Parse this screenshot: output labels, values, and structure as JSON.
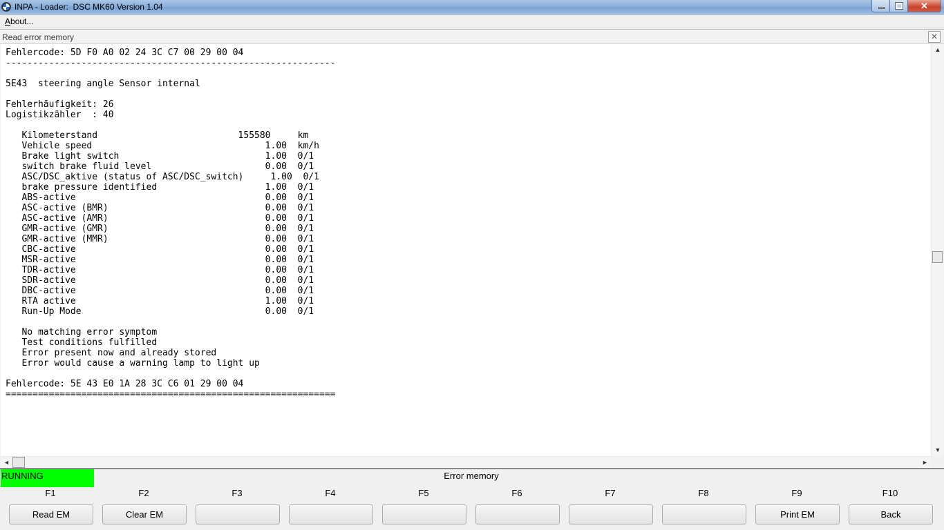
{
  "window": {
    "title": "INPA - Loader:  DSC MK60 Version 1.04"
  },
  "menu": {
    "about_label_underlined": "A",
    "about_label_rest": "bout..."
  },
  "panel": {
    "title": "Read error memory",
    "close_glyph": "✕"
  },
  "text_lines": [
    "Fehlercode: 5D F0 A0 02 24 3C C7 00 29 00 04",
    "-------------------------------------------------------------",
    "",
    "5E43  steering angle Sensor internal",
    "",
    "Fehlerhäufigkeit: 26",
    "Logistikzähler  : 40",
    "",
    "   Kilometerstand                          155580     km",
    "   Vehicle speed                                1.00  km/h",
    "   Brake light switch                           1.00  0/1",
    "   switch brake fluid level                     0.00  0/1",
    "   ASC/DSC_aktive (status of ASC/DSC_switch)     1.00  0/1",
    "   brake pressure identified                    1.00  0/1",
    "   ABS-active                                   0.00  0/1",
    "   ASC-active (BMR)                             0.00  0/1",
    "   ASC-active (AMR)                             0.00  0/1",
    "   GMR-active (GMR)                             0.00  0/1",
    "   GMR-active (MMR)                             0.00  0/1",
    "   CBC-active                                   0.00  0/1",
    "   MSR-active                                   0.00  0/1",
    "   TDR-active                                   0.00  0/1",
    "   SDR-active                                   0.00  0/1",
    "   DBC-active                                   0.00  0/1",
    "   RTA active                                   1.00  0/1",
    "   Run-Up Mode                                  0.00  0/1",
    "",
    "   No matching error symptom",
    "   Test conditions fulfilled",
    "   Error present now and already stored",
    "   Error would cause a warning lamp to light up",
    "",
    "Fehlercode: 5E 43 E0 1A 28 3C C6 01 29 00 04",
    "============================================================="
  ],
  "status": {
    "running_text": "RUNNING",
    "running_color": "#00ff00",
    "title": "Error memory"
  },
  "function_keys": [
    {
      "key": "F1",
      "label": "Read EM"
    },
    {
      "key": "F2",
      "label": "Clear EM"
    },
    {
      "key": "F3",
      "label": ""
    },
    {
      "key": "F4",
      "label": ""
    },
    {
      "key": "F5",
      "label": ""
    },
    {
      "key": "F6",
      "label": ""
    },
    {
      "key": "F7",
      "label": ""
    },
    {
      "key": "F8",
      "label": ""
    },
    {
      "key": "F9",
      "label": "Print EM"
    },
    {
      "key": "F10",
      "label": "Back"
    }
  ],
  "icons": {
    "scroll_up": "▲",
    "scroll_down": "▼",
    "scroll_left": "◄",
    "scroll_right": "►",
    "close": "✕"
  }
}
